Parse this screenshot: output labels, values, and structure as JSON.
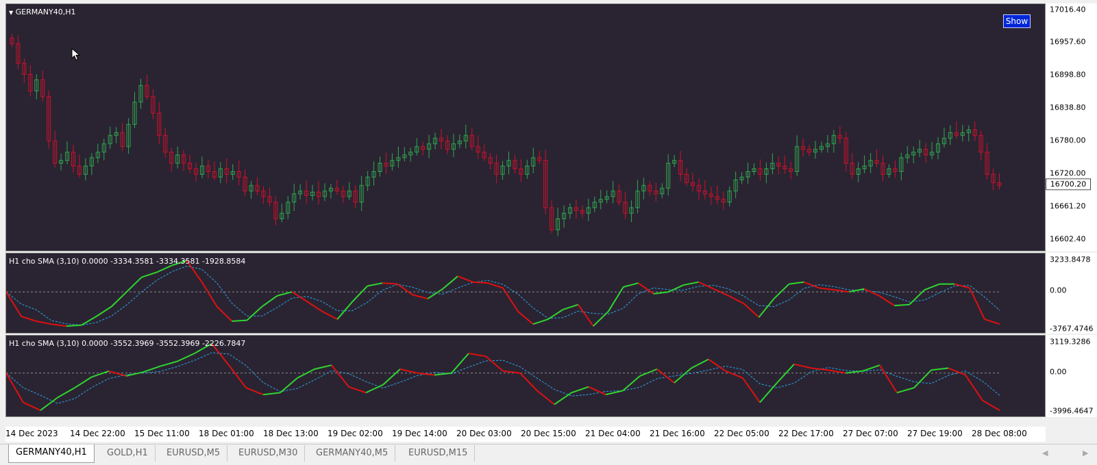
{
  "main_chart": {
    "title": "GERMANY40,H1",
    "show_button": "Show",
    "current_price": "16700.20",
    "price_labels": [
      "17016.40",
      "16957.60",
      "16898.80",
      "16838.80",
      "16780.00",
      "16720.00",
      "16661.20",
      "16602.40"
    ],
    "bull_color": "#2fa84f",
    "bear_color": "#d0102b"
  },
  "indicator1": {
    "title": "H1 cho  SMA (3,10) 0.0000 -3334.3581 -3334.3581 -1928.8584",
    "scale_labels": [
      "3233.8478",
      "0.00",
      "-3767.4746"
    ]
  },
  "indicator2": {
    "title": "H1 cho  SMA (3,10) 0.0000 -3552.3969 -3552.3969 -2226.7847",
    "scale_labels": [
      "3119.3286",
      "0.00",
      "-3996.4647"
    ]
  },
  "time_axis": [
    "14 Dec 2023",
    "14 Dec 22:00",
    "15 Dec 11:00",
    "18 Dec 01:00",
    "18 Dec 13:00",
    "19 Dec 02:00",
    "19 Dec 14:00",
    "20 Dec 03:00",
    "20 Dec 15:00",
    "21 Dec 04:00",
    "21 Dec 16:00",
    "22 Dec 05:00",
    "22 Dec 17:00",
    "27 Dec 07:00",
    "27 Dec 19:00",
    "28 Dec 08:00"
  ],
  "tabs": [
    "GERMANY40,H1",
    "GOLD,H1",
    "EURUSD,M5",
    "EURUSD,M30",
    "GERMANY40,M5",
    "EURUSD,M15"
  ],
  "chart_data": [
    {
      "type": "candlestick",
      "title": "GERMANY40,H1",
      "ylim": [
        16602.4,
        17016.4
      ],
      "x_labels": [
        "14 Dec 2023",
        "14 Dec 22:00",
        "15 Dec 11:00",
        "18 Dec 01:00",
        "18 Dec 13:00",
        "19 Dec 02:00",
        "19 Dec 14:00",
        "20 Dec 03:00",
        "20 Dec 15:00",
        "21 Dec 04:00",
        "21 Dec 16:00",
        "22 Dec 05:00",
        "22 Dec 17:00",
        "27 Dec 07:00",
        "27 Dec 19:00",
        "28 Dec 08:00"
      ],
      "close": [
        16955,
        16920,
        16900,
        16870,
        16890,
        16860,
        16780,
        16740,
        16745,
        16760,
        16735,
        16720,
        16735,
        16750,
        16760,
        16775,
        16790,
        16795,
        16770,
        16810,
        16850,
        16880,
        16860,
        16830,
        16790,
        16760,
        16740,
        16755,
        16740,
        16730,
        16720,
        16735,
        16725,
        16715,
        16730,
        16720,
        16725,
        16715,
        16690,
        16700,
        16690,
        16680,
        16670,
        16640,
        16650,
        16670,
        16685,
        16690,
        16682,
        16688,
        16680,
        16690,
        16695,
        16690,
        16680,
        16690,
        16670,
        16700,
        16715,
        16725,
        16740,
        16735,
        16745,
        16750,
        16755,
        16760,
        16770,
        16765,
        16775,
        16785,
        16780,
        16765,
        16775,
        16780,
        16790,
        16770,
        16760,
        16750,
        16740,
        16720,
        16735,
        16745,
        16730,
        16720,
        16735,
        16750,
        16745,
        16660,
        16620,
        16640,
        16650,
        16660,
        16655,
        16650,
        16660,
        16670,
        16675,
        16680,
        16690,
        16670,
        16650,
        16660,
        16690,
        16700,
        16690,
        16685,
        16695,
        16740,
        16745,
        16720,
        16705,
        16700,
        16690,
        16685,
        16680,
        16675,
        16670,
        16690,
        16710,
        16715,
        16725,
        16730,
        16720,
        16730,
        16740,
        16735,
        16730,
        16725,
        16770,
        16765,
        16760,
        16765,
        16770,
        16775,
        16790,
        16785,
        16740,
        16720,
        16730,
        16735,
        16745,
        16740,
        16720,
        16730,
        16725,
        16750,
        16755,
        16760,
        16765,
        16755,
        16760,
        16775,
        16785,
        16795,
        16790,
        16795,
        16800,
        16790,
        16760,
        16720,
        16705,
        16700
      ]
    },
    {
      "type": "line",
      "title": "H1 cho  SMA (3,10) 0.0000 -3334.3581 -3334.3581 -1928.8584",
      "ylim": [
        -3767.4746,
        3233.8478
      ],
      "series": [
        {
          "values": [
            0,
            -2500,
            -3000,
            -3300,
            -3500,
            -3400,
            -2500,
            -1500,
            0,
            1500,
            2000,
            2700,
            3200,
            1000,
            -1500,
            -3000,
            -2900,
            -1500,
            -400,
            0,
            -1000,
            -2000,
            -2800,
            -1000,
            600,
            900,
            800,
            -300,
            -700,
            300,
            1600,
            1000,
            900,
            400,
            -2000,
            -3300,
            -2800,
            -1800,
            -1300,
            -3500,
            -2000,
            500,
            900,
            -200,
            0,
            700,
            1000,
            300,
            -400,
            -1200,
            -2600,
            -700,
            800,
            1000,
            400,
            200,
            0,
            300,
            -400,
            -1400,
            -1300,
            200,
            800,
            800,
            400,
            -2800,
            -3300
          ]
        }
      ]
    },
    {
      "type": "line",
      "title": "H1 cho  SMA (3,10) 0.0000 -3552.3969 -3552.3969 -2226.7847",
      "ylim": [
        -3996.4647,
        3119.3286
      ],
      "series": [
        {
          "values": [
            0,
            -3000,
            -3800,
            -2500,
            -1500,
            -400,
            200,
            -300,
            100,
            700,
            1200,
            2000,
            3000,
            800,
            -1500,
            -2200,
            -2000,
            -500,
            400,
            800,
            -1400,
            -2000,
            -1200,
            400,
            0,
            -200,
            0,
            2000,
            1700,
            200,
            0,
            -1800,
            -3200,
            -2000,
            -1400,
            -2200,
            -1800,
            -300,
            400,
            -1000,
            500,
            1400,
            200,
            -500,
            -3000,
            -1000,
            900,
            500,
            300,
            0,
            200,
            800,
            -2000,
            -1500,
            300,
            500,
            -200,
            -2800,
            -3800
          ]
        }
      ]
    }
  ]
}
